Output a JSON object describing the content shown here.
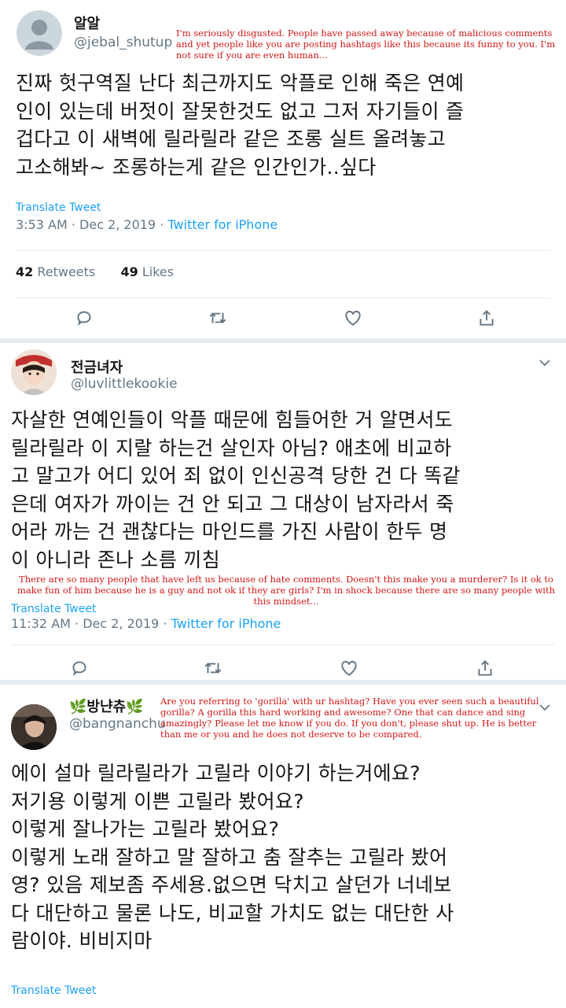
{
  "tweets": [
    {
      "name": "알알",
      "handle": "@jebal_shutup",
      "text": "진짜 헛구역질 난다 최근까지도 악플로 인해 죽은 연예\n인이 있는데 버젓이 잘못한것도 없고 그저 자기들이 즐\n겁다고 이 새벽에 릴라릴라 같은 조롱 실트 올려놓고\n고소해봐~ 조롱하는게 같은 인간인가..싶다",
      "translate": "Translate Tweet",
      "time": "3:53 AM · Dec 2, 2019 · ",
      "source": "Twitter for iPhone",
      "retweets_count": "42",
      "retweets_label": "Retweets",
      "likes_count": "49",
      "likes_label": "Likes",
      "note": "I'm seriously disgusted. People have passed away because of malicious comments and yet people like you are posting hashtags like this because its funny to you. I'm not sure if you are even human..."
    },
    {
      "name": "전금녀자",
      "handle": "@luvlittlekookie",
      "text": "자살한 연예인들이 악플 때문에 힘들어한 거 알면서도\n릴라릴라 이 지랄 하는건 살인자 아님? 애초에 비교하\n고 말고가 어디 있어 죄 없이 인신공격 당한 건 다 똑같\n은데 여자가 까이는 건 안 되고 그 대상이 남자라서 죽\n어라 까는 건 괜찮다는 마인드를 가진 사람이 한두 명\n이 아니라 존나 소름 끼침",
      "translate": "Translate Tweet",
      "time": "11:32 AM · Dec 2, 2019 · ",
      "source": "Twitter for iPhone",
      "note": "There are so many people that have left us because of hate comments. Doesn't this make you a murderer? Is it ok to make fun of him because he is a guy and not ok if they are girls? I'm in shock because there are so many people with this mindset..."
    },
    {
      "name": "🌿방냔츄🌿",
      "handle": "@bangnanchu",
      "text": "에이 설마 릴라릴라가 고릴라 이야기 하는거에요?\n저기용 이렇게 이쁜 고릴라 봤어요?\n이렇게 잘나가는 고릴라 봤어요?\n이렇게 노래 잘하고 말 잘하고 춤 잘추는 고릴라 봤어\n영? 있음 제보좀 주세용.없으면 닥치고 살던가 너네보\n다 대단하고 물론 나도, 비교할 가치도 없는  대단한 사\n람이야. 비비지마",
      "translate": "Translate Tweet",
      "note": "Are you referring to 'gorilla' with ur hashtag? Have you ever seen such a beautiful gorilla? A gorilla this hard working and awesome? One that can dance and sing amazingly? Please let me know if you do. If you don't, please shut up. He is better than me or you and he does not deserve to be compared."
    }
  ],
  "colors": {
    "link": "#1da1f2",
    "secondary": "#657786",
    "annotation": "#d01818",
    "separator": "#e6ecf0"
  },
  "icons": [
    "reply-icon",
    "retweet-icon",
    "like-icon",
    "share-icon",
    "chevron-down-icon",
    "default-avatar-icon"
  ]
}
